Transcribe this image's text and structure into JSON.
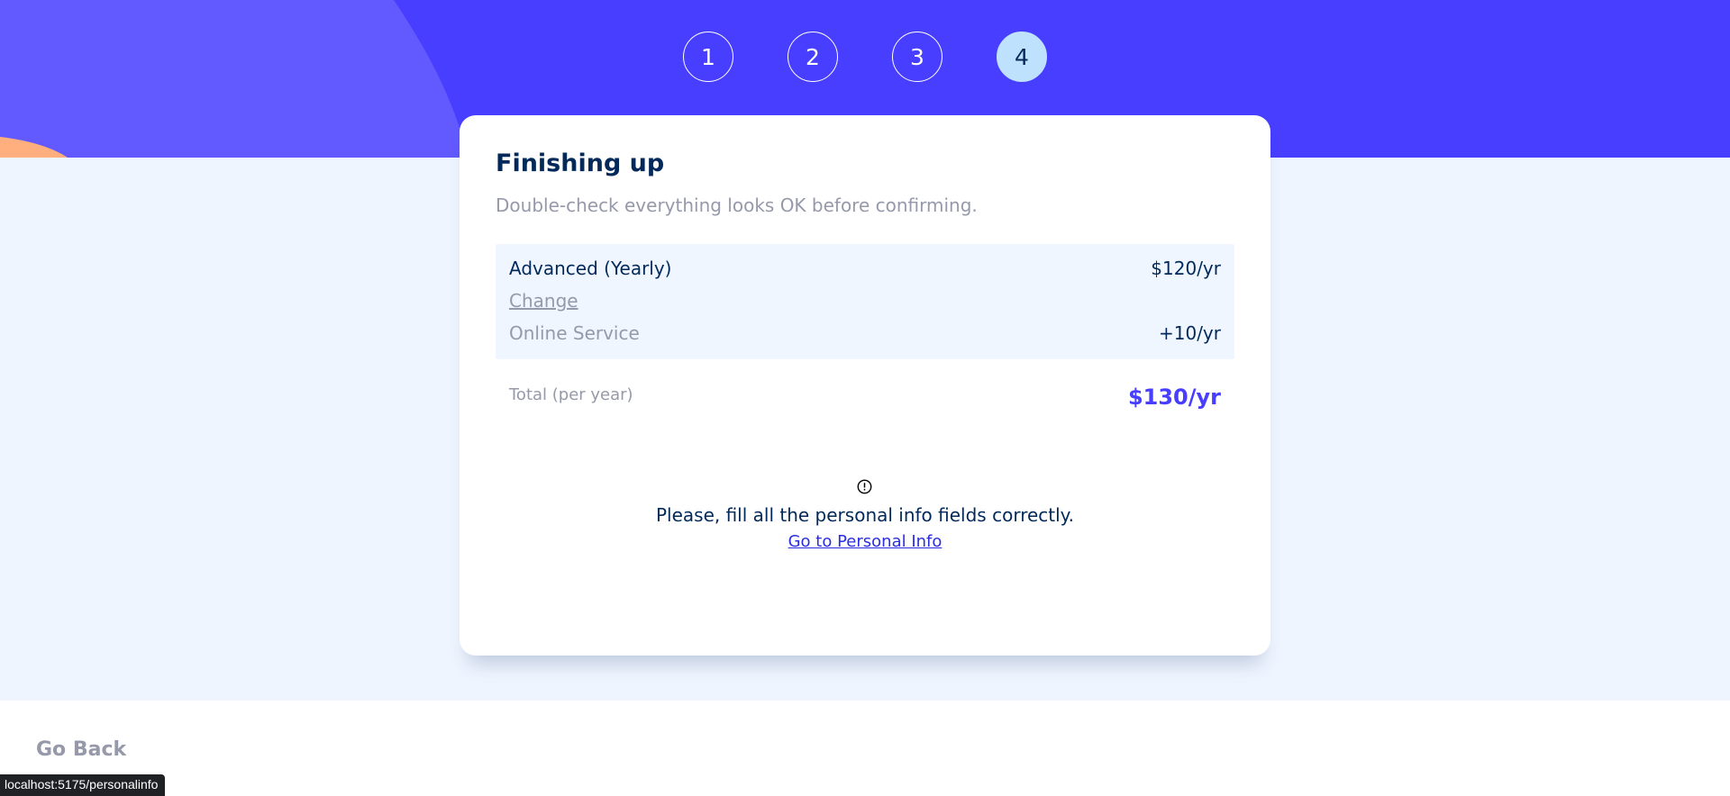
{
  "steps": [
    "1",
    "2",
    "3",
    "4"
  ],
  "active_step": "4",
  "summary": {
    "title": "Finishing up",
    "subtitle": "Double-check everything looks OK before confirming.",
    "plan_name": "Advanced (Yearly)",
    "plan_price": "$120/yr",
    "change_label": "Change",
    "addon_name": "Online Service",
    "addon_price": "+10/yr",
    "total_label": "Total (per year)",
    "total_value": "$130/yr"
  },
  "alert": {
    "icon": "info-circle-icon",
    "message": "Please, fill all the personal info fields correctly.",
    "link_label": "Go to Personal Info"
  },
  "footer": {
    "go_back_label": "Go Back"
  },
  "status_bar": {
    "url": "localhost:5175/personalinfo"
  },
  "colors": {
    "primary": "#483eff",
    "hero_light": "#6259ff",
    "accent_orange": "#ffaf7e",
    "active_step_bg": "#bee2fd",
    "marine_blue": "#022959",
    "grey_text": "#9699aa",
    "page_bg": "#eff5ff"
  }
}
